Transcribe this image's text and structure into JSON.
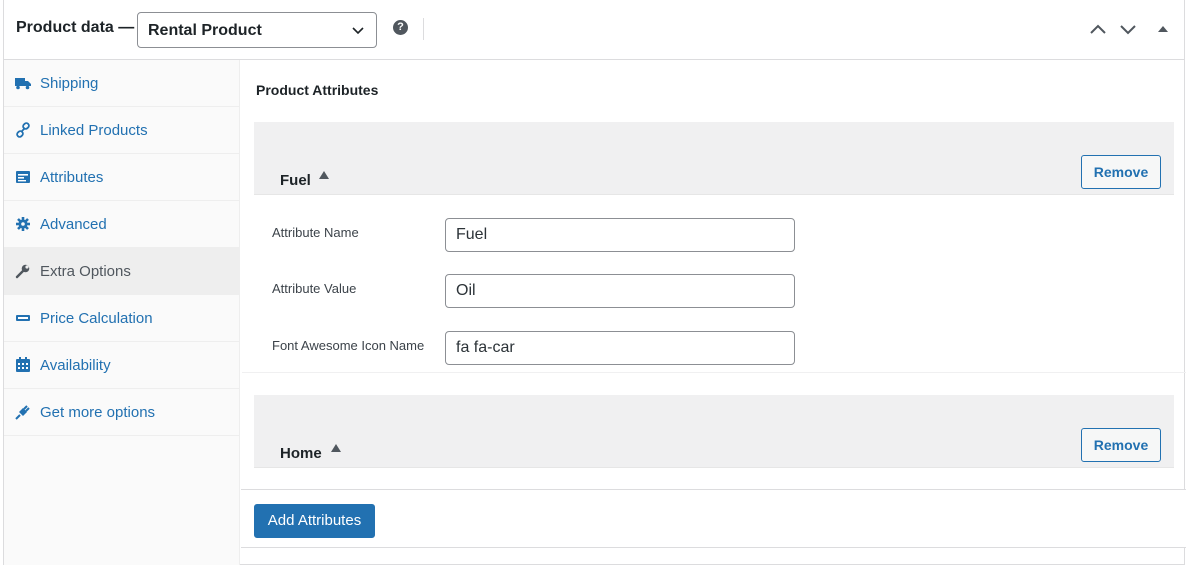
{
  "header": {
    "title": "Product data —",
    "product_type": "Rental Product",
    "help": "?"
  },
  "sidebar": {
    "items": [
      {
        "label": "Shipping",
        "icon": "truck-icon"
      },
      {
        "label": "Linked Products",
        "icon": "link-icon"
      },
      {
        "label": "Attributes",
        "icon": "list-icon"
      },
      {
        "label": "Advanced",
        "icon": "gear-icon"
      },
      {
        "label": "Extra Options",
        "icon": "wrench-icon",
        "active": true
      },
      {
        "label": "Price Calculation",
        "icon": "ticket-icon"
      },
      {
        "label": "Availability",
        "icon": "calendar-icon"
      },
      {
        "label": "Get more options",
        "icon": "plug-icon"
      }
    ]
  },
  "main": {
    "title": "Product Attributes",
    "attributes": [
      {
        "name": "Fuel",
        "remove_label": "Remove",
        "fields": [
          {
            "label": "Attribute Name",
            "value": "Fuel"
          },
          {
            "label": "Attribute Value",
            "value": "Oil"
          },
          {
            "label": "Font Awesome Icon Name",
            "value": "fa fa-car"
          }
        ]
      },
      {
        "name": "Home",
        "remove_label": "Remove"
      }
    ],
    "add_label": "Add Attributes"
  },
  "colors": {
    "accent": "#2271b1",
    "text": "#1d2327",
    "muted": "#50575e",
    "header_bg": "#f0f0f1"
  }
}
